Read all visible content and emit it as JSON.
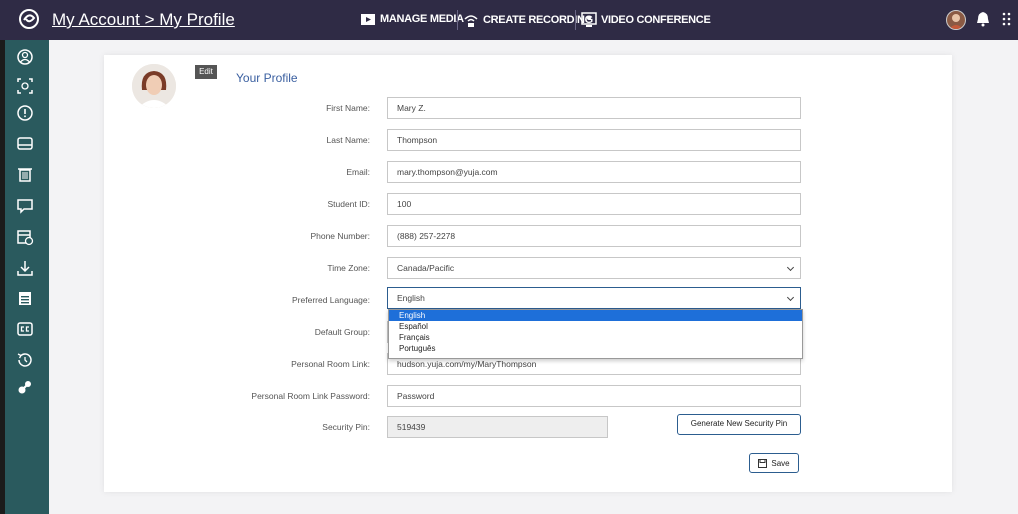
{
  "header": {
    "breadcrumb": "My Account > My Profile",
    "nav": {
      "manage_media": "MANAGE MEDIA",
      "create_recording": "CREATE RECORDING",
      "video_conference": "VIDEO CONFERENCE"
    }
  },
  "sidebar": {
    "items": [
      "account-icon",
      "capture-icon",
      "info-icon",
      "inbox-icon",
      "trash-icon",
      "chat-icon",
      "calendar-icon",
      "download-icon",
      "schedule-icon",
      "captions-icon",
      "history-icon",
      "integrations-icon"
    ]
  },
  "profile": {
    "edit_label": "Edit",
    "title": "Your Profile",
    "fields": {
      "first_name": {
        "label": "First Name:",
        "value": "Mary Z."
      },
      "last_name": {
        "label": "Last Name:",
        "value": "Thompson"
      },
      "email": {
        "label": "Email:",
        "value": "mary.thompson@yuja.com"
      },
      "student_id": {
        "label": "Student ID:",
        "value": "100"
      },
      "phone": {
        "label": "Phone Number:",
        "value": "(888) 257-2278"
      },
      "time_zone": {
        "label": "Time Zone:",
        "value": "Canada/Pacific"
      },
      "language": {
        "label": "Preferred Language:",
        "value": "English"
      },
      "default_group": {
        "label": "Default Group:",
        "value": ""
      },
      "room_link": {
        "label": "Personal Room Link:",
        "value": "hudson.yuja.com/my/MaryThompson"
      },
      "room_password": {
        "label": "Personal Room Link Password:",
        "placeholder": "Password"
      },
      "security_pin": {
        "label": "Security Pin:",
        "value": "519439"
      }
    },
    "language_options": [
      "English",
      "Español",
      "Français",
      "Português"
    ],
    "generate_pin_label": "Generate New Security Pin",
    "save_label": "Save"
  },
  "colors": {
    "topbar": "#2f2b45",
    "sidebar": "#2a5a5e",
    "accent": "#2c5d8f",
    "selected_option": "#1e6fd9"
  }
}
